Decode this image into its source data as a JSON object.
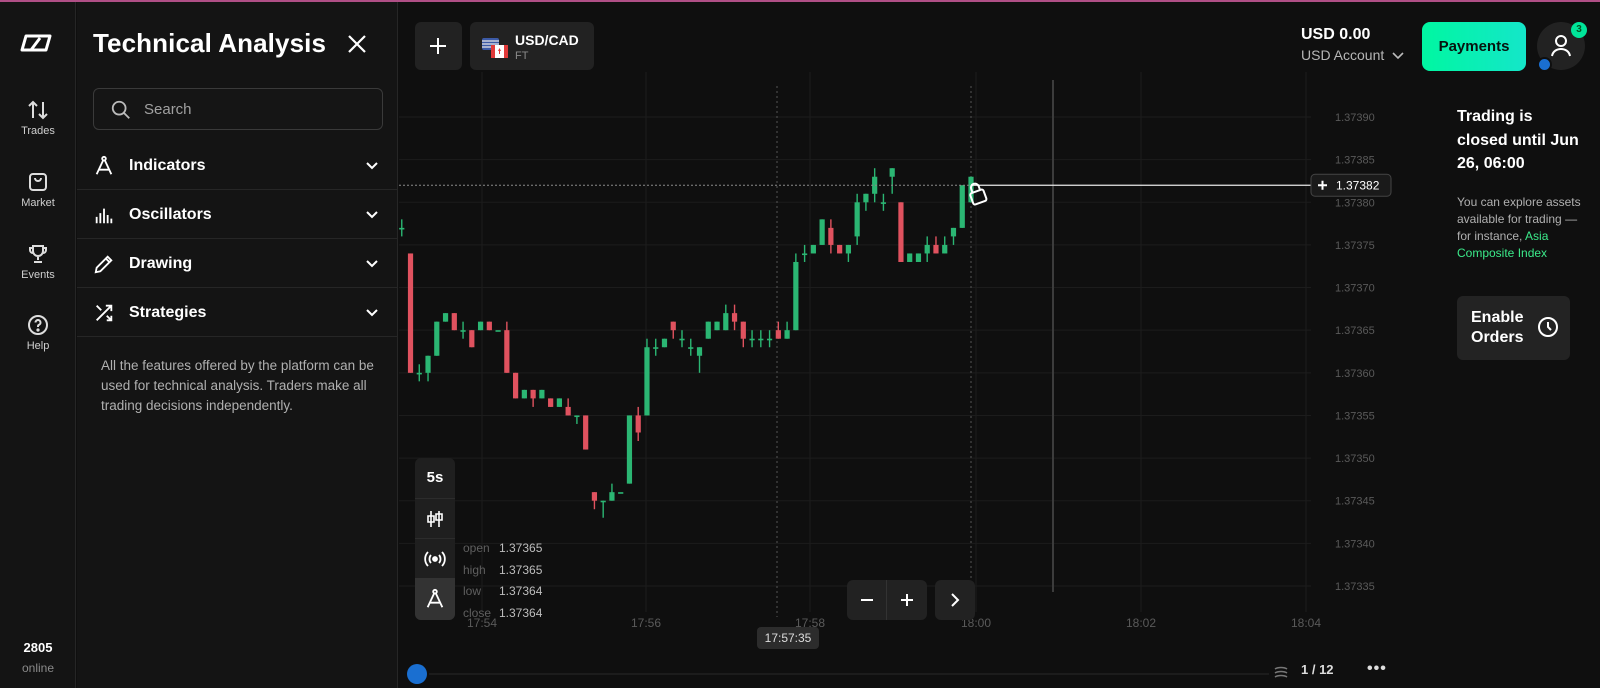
{
  "panel": {
    "title": "Technical Analysis",
    "search_placeholder": "Search",
    "sections": [
      {
        "label": "Indicators",
        "icon": "compass-icon"
      },
      {
        "label": "Oscillators",
        "icon": "bar-chart-icon"
      },
      {
        "label": "Drawing",
        "icon": "pencil-icon"
      },
      {
        "label": "Strategies",
        "icon": "shuffle-icon"
      }
    ],
    "description": "All the features offered by the platform can be used for technical analysis. Traders make all trading decisions independently."
  },
  "rail": {
    "items": [
      {
        "label": "Trades",
        "icon": "arrows-updown-icon"
      },
      {
        "label": "Market",
        "icon": "bag-icon"
      },
      {
        "label": "Events",
        "icon": "trophy-icon"
      },
      {
        "label": "Help",
        "icon": "help-icon"
      }
    ],
    "online_count": "2805",
    "online_label": "online"
  },
  "header": {
    "asset_name": "USD/CAD",
    "asset_type": "FT",
    "balance": "USD 0.00",
    "account": "USD Account",
    "payments_label": "Payments",
    "notification_count": "3"
  },
  "notice": {
    "title": "Trading is closed until Jun 26, 06:00",
    "body_prefix": "You can explore assets available for trading — for instance, ",
    "body_link": "Asia Composite Index",
    "enable_label": "Enable Orders"
  },
  "toolbar": {
    "timeframe": "5s"
  },
  "ohlc": {
    "open_label": "open",
    "open": "1.37365",
    "high_label": "high",
    "high": "1.37365",
    "low_label": "low",
    "low": "1.37364",
    "close_label": "close",
    "close": "1.37364"
  },
  "timeline": {
    "cursor_time": "17:57:35",
    "pager": "1 / 12"
  },
  "colors": {
    "up": "#2bb673",
    "down": "#e0525f",
    "accent": "#00f7a1"
  },
  "chart_data": {
    "type": "candlestick",
    "ylim": [
      1.37333,
      1.37392
    ],
    "y_ticks": [
      "1.37390",
      "1.37385",
      "1.37380",
      "1.37375",
      "1.37370",
      "1.37365",
      "1.37360",
      "1.37355",
      "1.37350",
      "1.37345",
      "1.37340",
      "1.37335"
    ],
    "x_ticks": [
      "17:54",
      "17:56",
      "17:58",
      "18:00",
      "18:02",
      "18:04"
    ],
    "current_price": "1.37382",
    "candles": [
      [
        1.37381,
        1.37384,
        1.3738,
        1.37384
      ],
      [
        1.37377,
        1.37378,
        1.37376,
        1.37377
      ],
      [
        1.37374,
        1.37374,
        1.3736,
        1.3736
      ],
      [
        1.3736,
        1.37361,
        1.37359,
        1.3736
      ],
      [
        1.3736,
        1.37362,
        1.37359,
        1.37362
      ],
      [
        1.37362,
        1.37366,
        1.37362,
        1.37366
      ],
      [
        1.37366,
        1.37367,
        1.37366,
        1.37367
      ],
      [
        1.37367,
        1.37367,
        1.37365,
        1.37365
      ],
      [
        1.37365,
        1.37366,
        1.37364,
        1.37365
      ],
      [
        1.37365,
        1.37365,
        1.37363,
        1.37363
      ],
      [
        1.37365,
        1.37366,
        1.37365,
        1.37366
      ],
      [
        1.37366,
        1.37366,
        1.37365,
        1.37365
      ],
      [
        1.37365,
        1.37365,
        1.37365,
        1.37365
      ],
      [
        1.37365,
        1.37366,
        1.3736,
        1.3736
      ],
      [
        1.3736,
        1.3736,
        1.37357,
        1.37357
      ],
      [
        1.37357,
        1.37358,
        1.37357,
        1.37358
      ],
      [
        1.37358,
        1.37358,
        1.37356,
        1.37357
      ],
      [
        1.37357,
        1.37358,
        1.37357,
        1.37358
      ],
      [
        1.37357,
        1.37357,
        1.37356,
        1.37356
      ],
      [
        1.37356,
        1.37357,
        1.37356,
        1.37357
      ],
      [
        1.37356,
        1.37357,
        1.37355,
        1.37355
      ],
      [
        1.37355,
        1.37355,
        1.37354,
        1.37355
      ],
      [
        1.37355,
        1.37355,
        1.37351,
        1.37351
      ],
      [
        1.37346,
        1.37346,
        1.37344,
        1.37345
      ],
      [
        1.37345,
        1.37345,
        1.37343,
        1.37345
      ],
      [
        1.37345,
        1.37347,
        1.37345,
        1.37346
      ],
      [
        1.37346,
        1.37346,
        1.37346,
        1.37346
      ],
      [
        1.37347,
        1.37355,
        1.37347,
        1.37355
      ],
      [
        1.37355,
        1.37356,
        1.37352,
        1.37353
      ],
      [
        1.37355,
        1.37364,
        1.37355,
        1.37363
      ],
      [
        1.37363,
        1.37364,
        1.37362,
        1.37363
      ],
      [
        1.37363,
        1.37364,
        1.37363,
        1.37364
      ],
      [
        1.37366,
        1.37366,
        1.37364,
        1.37365
      ],
      [
        1.37364,
        1.37365,
        1.37363,
        1.37364
      ],
      [
        1.37363,
        1.37364,
        1.37362,
        1.37363
      ],
      [
        1.37362,
        1.37363,
        1.3736,
        1.37363
      ],
      [
        1.37364,
        1.37366,
        1.37364,
        1.37366
      ],
      [
        1.37365,
        1.37366,
        1.37365,
        1.37366
      ],
      [
        1.37365,
        1.37368,
        1.37365,
        1.37367
      ],
      [
        1.37367,
        1.37368,
        1.37365,
        1.37366
      ],
      [
        1.37366,
        1.37366,
        1.37363,
        1.37364
      ],
      [
        1.37364,
        1.37365,
        1.37363,
        1.37364
      ],
      [
        1.37364,
        1.37365,
        1.37363,
        1.37364
      ],
      [
        1.37364,
        1.37365,
        1.37363,
        1.37364
      ],
      [
        1.37365,
        1.37366,
        1.37364,
        1.37364
      ],
      [
        1.37364,
        1.37366,
        1.37364,
        1.37365
      ],
      [
        1.37365,
        1.37374,
        1.37365,
        1.37373
      ],
      [
        1.37374,
        1.37375,
        1.37373,
        1.37374
      ],
      [
        1.37374,
        1.37375,
        1.37374,
        1.37375
      ],
      [
        1.37375,
        1.37378,
        1.37375,
        1.37378
      ],
      [
        1.37377,
        1.37378,
        1.37374,
        1.37375
      ],
      [
        1.37375,
        1.37375,
        1.37374,
        1.37374
      ],
      [
        1.37374,
        1.37375,
        1.37373,
        1.37375
      ],
      [
        1.37376,
        1.37381,
        1.37375,
        1.3738
      ],
      [
        1.3738,
        1.37381,
        1.37379,
        1.37381
      ],
      [
        1.37381,
        1.37384,
        1.3738,
        1.37383
      ],
      [
        1.3738,
        1.37381,
        1.37379,
        1.3738
      ],
      [
        1.37383,
        1.37384,
        1.37381,
        1.37384
      ],
      [
        1.3738,
        1.3738,
        1.37373,
        1.37373
      ],
      [
        1.37373,
        1.37374,
        1.37373,
        1.37374
      ],
      [
        1.37373,
        1.37374,
        1.37373,
        1.37374
      ],
      [
        1.37374,
        1.37376,
        1.37373,
        1.37375
      ],
      [
        1.37375,
        1.37376,
        1.37374,
        1.37374
      ],
      [
        1.37374,
        1.37376,
        1.37374,
        1.37375
      ],
      [
        1.37376,
        1.37377,
        1.37375,
        1.37377
      ],
      [
        1.37377,
        1.37382,
        1.37377,
        1.37382
      ],
      [
        1.3738,
        1.37383,
        1.3738,
        1.37383
      ]
    ]
  }
}
